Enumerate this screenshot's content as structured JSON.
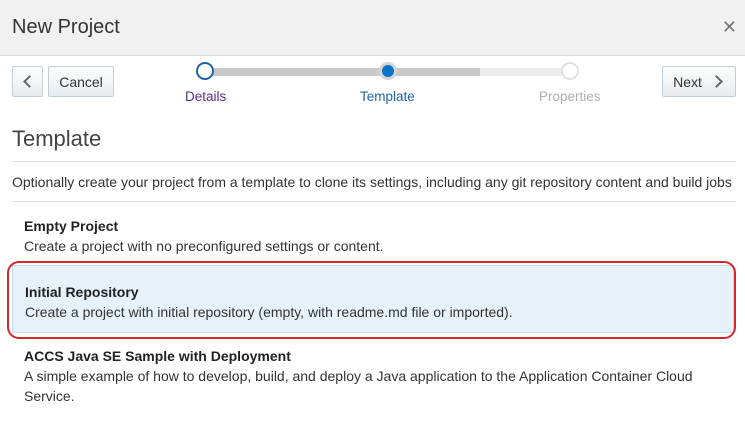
{
  "dialog": {
    "title": "New Project"
  },
  "toolbar": {
    "cancel_label": "Cancel",
    "next_label": "Next"
  },
  "wizard": {
    "steps": [
      {
        "label": "Details",
        "state": "completed"
      },
      {
        "label": "Template",
        "state": "current"
      },
      {
        "label": "Properties",
        "state": "pending"
      }
    ]
  },
  "section": {
    "title": "Template",
    "description": "Optionally create your project from a template to clone its settings, including any git repository content and build jobs"
  },
  "templates": [
    {
      "name": "Empty Project",
      "description": "Create a project with no preconfigured settings or content.",
      "selected": false
    },
    {
      "name": "Initial Repository",
      "description": "Create a project with initial repository (empty, with readme.md file or imported).",
      "selected": true
    },
    {
      "name": "ACCS Java SE Sample with Deployment",
      "description": "A simple example of how to develop, build, and deploy a Java application to the Application Container Cloud Service.",
      "selected": false
    }
  ],
  "colors": {
    "accent": "#0b73c7",
    "selected_bg": "#e6f1fa",
    "highlight": "#d3272e"
  }
}
